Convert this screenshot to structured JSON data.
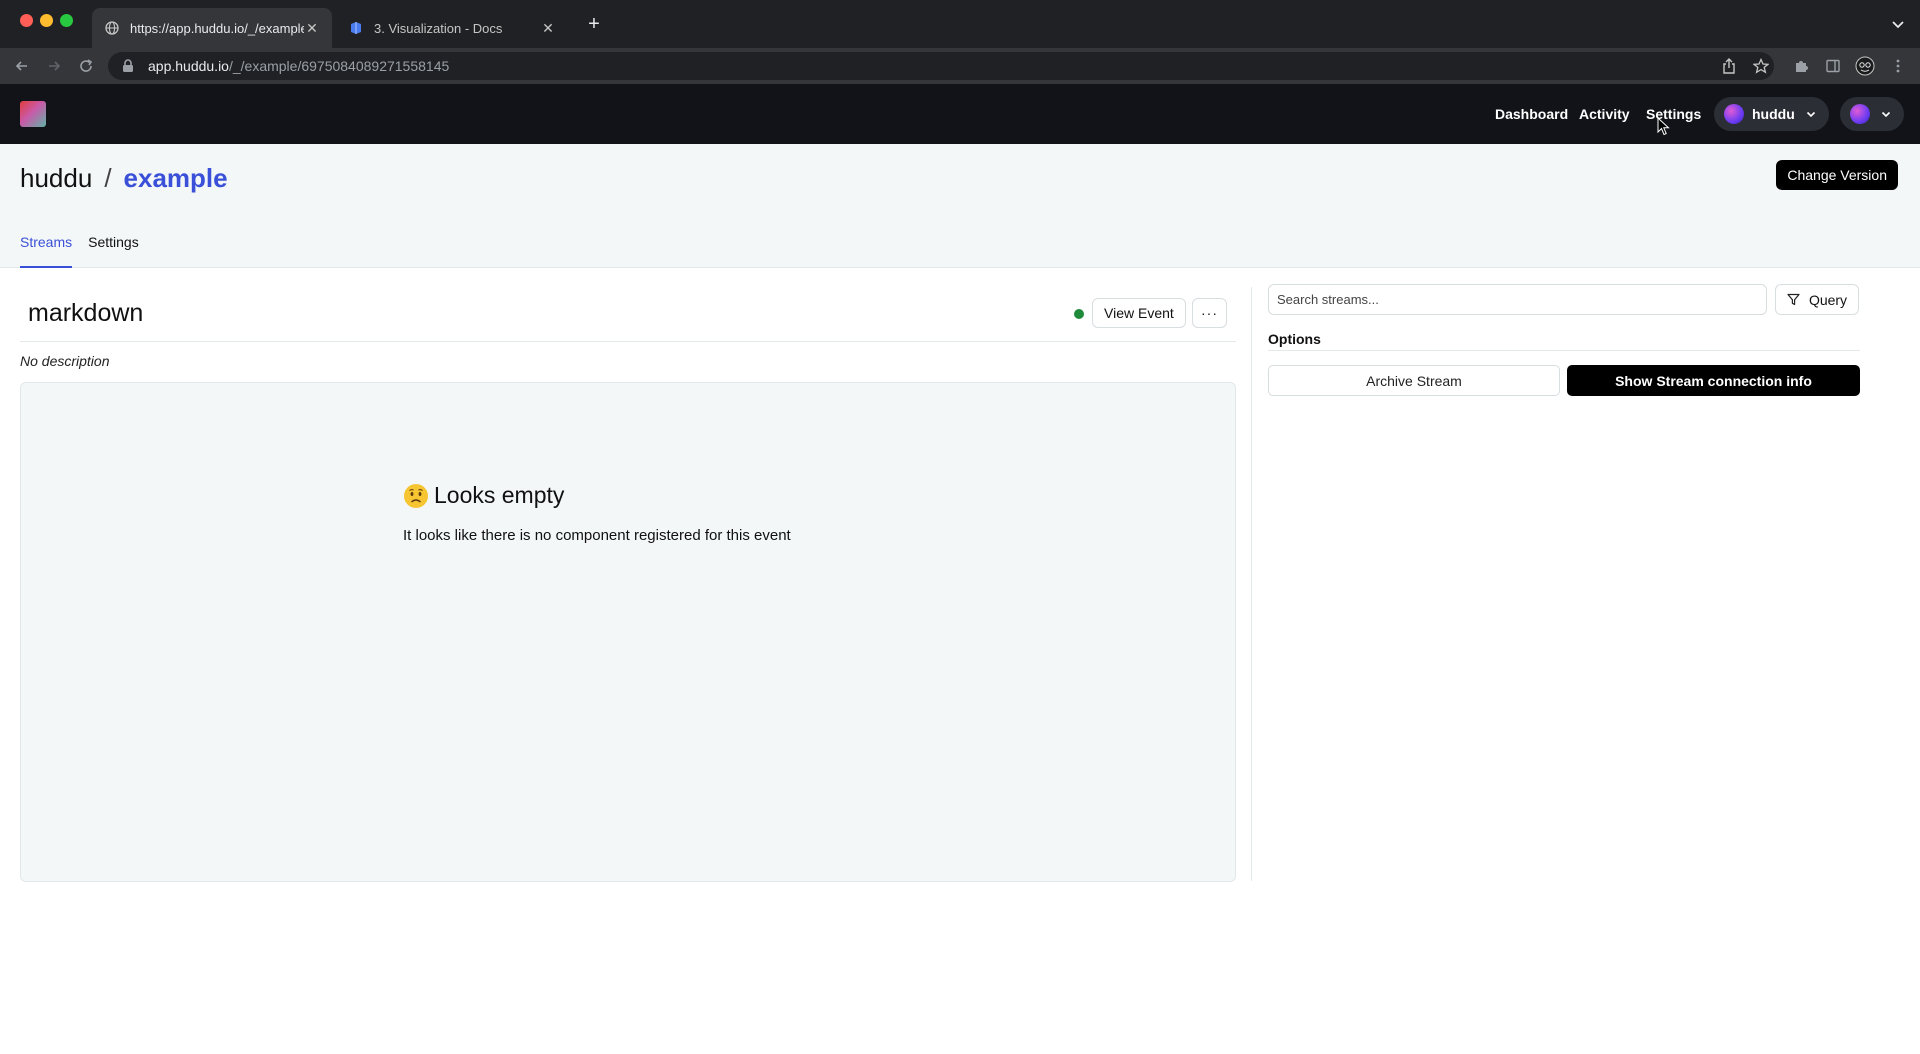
{
  "browser": {
    "tabs": [
      {
        "title": "https://app.huddu.io/_/example",
        "favicon": "globe-icon",
        "active": true
      },
      {
        "title": "3. Visualization - Docs",
        "favicon": "docs-book-icon",
        "active": false
      }
    ],
    "url_host": "app.huddu.io",
    "url_path": "/_/example/6975084089271558145"
  },
  "app": {
    "nav": {
      "dashboard": "Dashboard",
      "activity": "Activity",
      "settings": "Settings",
      "org_switcher": "huddu"
    },
    "breadcrumb": {
      "org": "huddu",
      "separator": "/",
      "project": "example"
    },
    "change_version": "Change Version",
    "tabs": {
      "streams": "Streams",
      "settings": "Settings"
    },
    "stream": {
      "name": "markdown",
      "status": "active",
      "status_color": "#1f8a3a",
      "view_event": "View Event",
      "more": "···",
      "description": "No description"
    },
    "empty_state": {
      "title": "Looks empty",
      "message": "It looks like there is no component registered for this event"
    },
    "sidebar": {
      "search_placeholder": "Search streams...",
      "query": "Query",
      "options_label": "Options",
      "archive": "Archive Stream",
      "connection_info": "Show Stream connection info"
    }
  },
  "colors": {
    "accent": "#3b50d8",
    "header_bg": "#111318",
    "page_bg": "#f3f7f8"
  }
}
